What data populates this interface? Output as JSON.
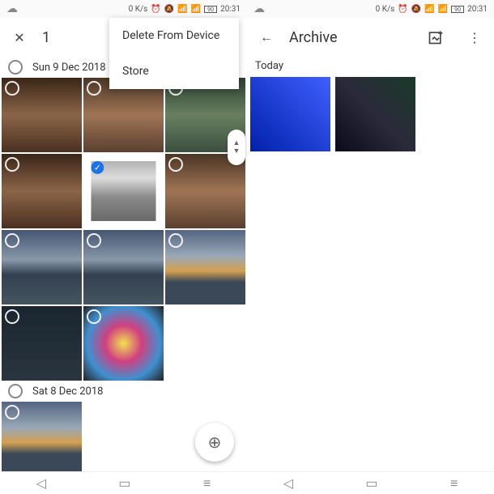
{
  "status": {
    "net": "0 K/s",
    "time": "20:31",
    "battery": "90"
  },
  "left": {
    "close": "✕",
    "count": "1",
    "menu": {
      "delete": "Delete From Device",
      "store": "Store"
    },
    "section1": "Sun 9 Dec 2018",
    "section2": "Sat 8 Dec 2018"
  },
  "right": {
    "back": "←",
    "title": "Archive",
    "section": "Today"
  }
}
